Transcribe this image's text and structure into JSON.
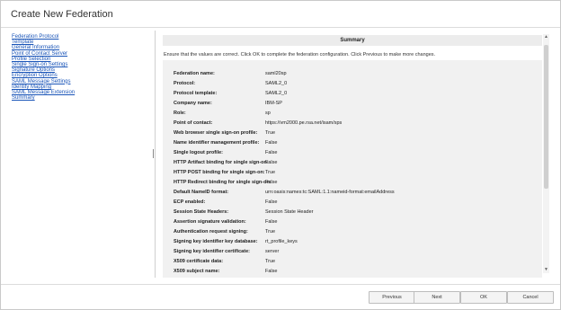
{
  "window": {
    "title": "Create New Federation"
  },
  "nav": {
    "items": [
      "Federation Protocol",
      "Template",
      "General Information",
      "Point of Contact Server",
      "Profile Selection",
      "Single Sign-on Settings",
      "Signature Options",
      "Encryption Options",
      "SAML Message Settings",
      "Identity Mapping",
      "SAML Message Extension",
      "Summary"
    ]
  },
  "summary": {
    "header": "Summary",
    "instructions": "Ensure that the values are correct. Click OK to complete the federation configuration. Click Previous to make more changes.",
    "rows": [
      {
        "label": "Federation name:",
        "value": "saml20sp"
      },
      {
        "label": "Protocol:",
        "value": "SAML2_0"
      },
      {
        "label": "Protocol template:",
        "value": "SAML2_0"
      },
      {
        "label": "Company name:",
        "value": "IBM-SP"
      },
      {
        "label": "Role:",
        "value": "sp"
      },
      {
        "label": "Point of contact:",
        "value": "https://vm2000.pe.rsa.net/isam/sps"
      },
      {
        "label": "Web browser single sign-on profile:",
        "value": "True"
      },
      {
        "label": "Name identifier management profile:",
        "value": "False"
      },
      {
        "label": "Single logout profile:",
        "value": "False"
      },
      {
        "label": "HTTP Artifact binding for single sign-on:",
        "value": "False"
      },
      {
        "label": "HTTP POST binding for single sign-on:",
        "value": "True"
      },
      {
        "label": "HTTP Redirect binding for single sign-on:",
        "value": "False"
      },
      {
        "label": "Default NameID format:",
        "value": "urn:oasis:names:tc:SAML:1.1:nameid-format:emailAddress"
      },
      {
        "label": "ECP enabled:",
        "value": "False"
      },
      {
        "label": "Session State Headers:",
        "value": "Session State Header"
      },
      {
        "label": "Assertion signature validation:",
        "value": "False"
      },
      {
        "label": "Authentication request signing:",
        "value": "True"
      },
      {
        "label": "Signing key identifier key database:",
        "value": "rt_profile_keys"
      },
      {
        "label": "Signing key identifier certificate:",
        "value": "server"
      },
      {
        "label": "X509 certificate data:",
        "value": "True"
      },
      {
        "label": "X509 subject name:",
        "value": "False"
      }
    ]
  },
  "buttons": {
    "previous": "Previous",
    "next": "Next",
    "ok": "OK",
    "cancel": "Cancel"
  },
  "scrollbar": {
    "up_icon": "▲",
    "down_icon": "▼"
  }
}
